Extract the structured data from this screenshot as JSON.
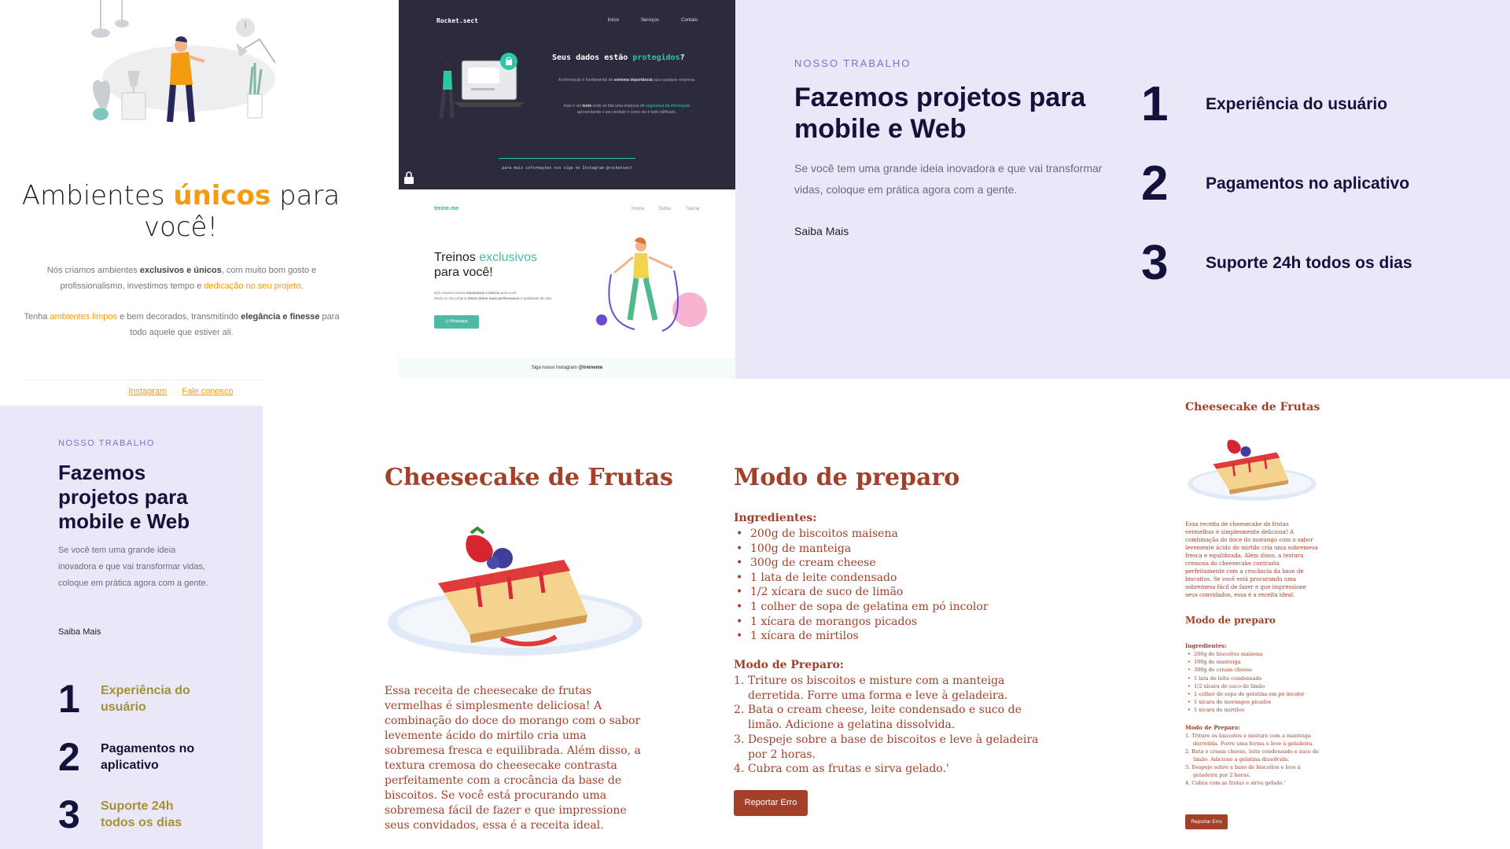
{
  "ambientes": {
    "title_before": "Ambientes ",
    "title_accent": "únicos",
    "title_after": " para você!",
    "p1_a": "Nós criamos ambientes ",
    "p1_b": "exclusivos e únicos",
    "p1_c": ", com muito bom gosto e profissionalismo, investimos tempo e ",
    "p1_d": "dedicação no seu projeto",
    "p1_e": ".",
    "p2_a": "Tenha ",
    "p2_b": "ambientes limpos",
    "p2_c": " e bem decorados, transmitindo ",
    "p2_d": "elegância e finesse",
    "p2_e": " para todo aquele que estiver ali.",
    "links": [
      "Instagram",
      "Fale conosco"
    ],
    "accent_color": "#f39c12"
  },
  "rocket": {
    "logo": "Rocket.sect",
    "nav": [
      "Início",
      "Serviços",
      "Contato"
    ],
    "heading_a": "Seus dados estão ",
    "heading_b": "protegidos",
    "heading_c": "?",
    "text1_a": "A informação é fundamental de ",
    "text1_b": "extrema importância",
    "text1_c": " para qualquer empresa.",
    "text2_a": "Aqui é um ",
    "text2_b": "teste",
    "text2_c": " onde se fala uma empresa de ",
    "text2_d": "segurança da informação",
    "text2_e": " apresentando o seu produto e como ele é todo edificado.",
    "footer": "para mais informações nos siga no Instagram @rocketsect",
    "accent_color": "#29c9a3"
  },
  "treine": {
    "logo": "treine.me",
    "nav": [
      "Home",
      "Sobre",
      "Treinar"
    ],
    "heading_a": "Treinos ",
    "heading_b": "exclusivos",
    "heading_c": "para você!",
    "text_a": "Nós criamos treinos ",
    "text_b": "exclusivos e únicos",
    "text_c": " para você.",
    "text_d": "Modo no seu próprio ",
    "text_e": "treino ótimo mais performance",
    "text_f": " e qualidade de vida.",
    "button": "Whatsapp",
    "footer_a": "Siga nosso Instagram ",
    "footer_b": "@treineme"
  },
  "nosso_wide": {
    "kicker": "NOSSO TRABALHO",
    "heading": "Fazemos projetos para mobile e Web",
    "text": "Se você tem uma grande ideia inovadora e que vai transformar vidas, coloque em prática agora com a gente.",
    "more": "Saiba Mais",
    "features": [
      {
        "num": "1",
        "label": "Experiência do usuário"
      },
      {
        "num": "2",
        "label": "Pagamentos no aplicativo"
      },
      {
        "num": "3",
        "label": "Suporte 24h todos os dias"
      }
    ]
  },
  "nosso_narrow": {
    "kicker": "NOSSO TRABALHO",
    "heading": "Fazemos projetos para mobile e Web",
    "text": "Se você tem uma grande ideia inovadora e que vai transformar vidas, coloque em prática agora com a gente.",
    "more": "Saiba Mais",
    "features": [
      {
        "num": "1",
        "label": "Experiência do usuário"
      },
      {
        "num": "2",
        "label": "Pagamentos no aplicativo"
      },
      {
        "num": "3",
        "label": "Suporte 24h todos os dias"
      }
    ]
  },
  "recipe": {
    "title": "Cheesecake de Frutas",
    "description": "Essa receita de cheesecake de frutas vermelhas é simplesmente deliciosa! A combinação do doce do morango com o sabor levemente ácido do mirtilo cria uma sobremesa fresca e equilibrada. Além disso, a textura cremosa do cheesecake contrasta perfeitamente com a crocância da base de biscoitos. Se você está procurando uma sobremesa fácil de fazer e que impressione seus convidados, essa é a receita ideal.",
    "method_title": "Modo de preparo",
    "ingredients_label": "Ingredientes:",
    "ingredients": [
      "200g de biscoitos maisena",
      "100g de manteiga",
      "300g de cream cheese",
      "1 lata de leite condensado",
      "1/2 xícara de suco de limão",
      "1 colher de sopa de gelatina em pó incolor",
      "1 xícara de morangos picados",
      "1 xícara de mirtilos"
    ],
    "steps_label": "Modo de Preparo:",
    "steps": [
      "Triture os biscoitos e misture com a manteiga derretida. Forre uma forma e leve à geladeira.",
      "Bata o cream cheese, leite condensado e suco de limão. Adicione a gelatina dissolvida.",
      "Despeje sobre a base de biscoitos e leve à geladeira por 2 horas.",
      "Cubra com as frutas e sirva gelado.'"
    ],
    "button": "Reportar Erro",
    "color": "#a3402a"
  }
}
